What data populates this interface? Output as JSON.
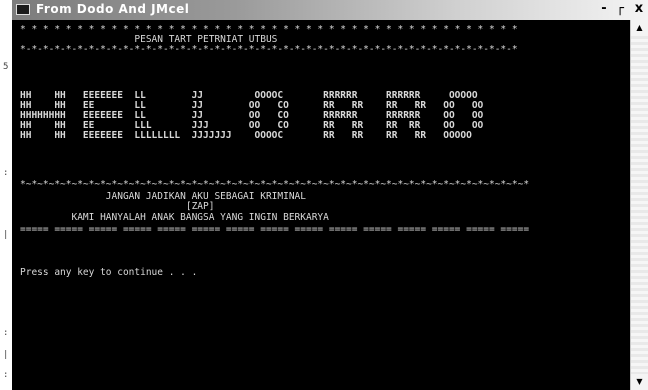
{
  "gutter": {
    "marks": [
      "5",
      ":",
      "|",
      ":",
      "|",
      ":"
    ]
  },
  "window": {
    "title": "From Dodo And JMcel",
    "controls": {
      "minimize": "-",
      "maximize": "┌",
      "close": "x"
    },
    "icon": "console-window-icon"
  },
  "console": {
    "lines": [
      "* * * * * * * * * * * * * * * * * * * * * * * * * * * * * * * * * * * * * * * * * * * *",
      "                    PESAN TART PETRNIAT UTBUS",
      "*-*-*-*-*-*-*-*-*-*-*-*-*-*-*-*-*-*-*-*-*-*-*-*-*-*-*-*-*-*-*-*-*-*-*-*-*-*-*-*-*-*-*-*",
      "",
      "",
      "HH    HH   EEEEEEE  LL        JJ         OOOOC       RRRRRR     RRRRRR     OOOOO",
      "HH    HH   EE       LL        JJ        OO   CO      RR   RR    RR   RR   OO   OO",
      "HHHHHHHH   EEEEEEE  LL        JJ        OO   CO      RRRRRR     RRRRRR    OO   OO",
      "HH    HH   EE       LLL       JJJ       OO   CO      RR   RR    RR  RR    OO   OO",
      "HH    HH   EEEEEEE  LLLLLLLL  JJJJJJJ    OOOOC       RR   RR    RR   RR   OOOOO",
      "",
      "",
      "*~*~*~*~*~*~*~*~*~*~*~*~*~*~*~*~*~*~*~*~*~*~*~*~*~*~*~*~*~*~*~*~*~*~*~*~*~*~*~*~*~*~*~*~*",
      "               JANGAN JADIKAN AKU SEBAGAI KRIMINAL",
      "                             [ZAP]",
      "         KAMI HANYALAH ANAK BANGSA YANG INGIN BERKARYA",
      "===== ===== ===== ===== ===== ===== ===== ===== ===== ===== ===== ===== ===== ===== =====",
      "",
      "Press any key to continue . . ."
    ]
  }
}
